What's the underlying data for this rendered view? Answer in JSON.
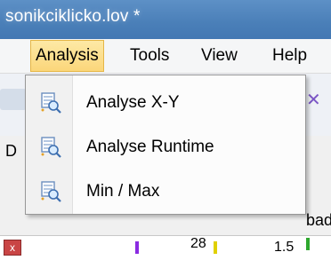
{
  "window": {
    "title": "sonikciklicko.lov *"
  },
  "menubar": {
    "items": [
      {
        "label": "Analysis"
      },
      {
        "label": "Tools"
      },
      {
        "label": "View"
      },
      {
        "label": "Help"
      }
    ]
  },
  "dropdown": {
    "items": [
      {
        "label": "Analyse X-Y",
        "icon": "magnifier-table-icon"
      },
      {
        "label": "Analyse Runtime",
        "icon": "magnifier-table-icon"
      },
      {
        "label": "Min / Max",
        "icon": "magnifier-table-icon"
      }
    ]
  },
  "background": {
    "left_fragment": "D",
    "panel_label_fragment": "bad",
    "plot_tick_a": "28",
    "plot_tick_b": "1.5"
  },
  "colors": {
    "titlebar": "#4a7fb8",
    "menu_highlight": "#fbd67a",
    "dropdown_bg": "#fcfcfc"
  }
}
